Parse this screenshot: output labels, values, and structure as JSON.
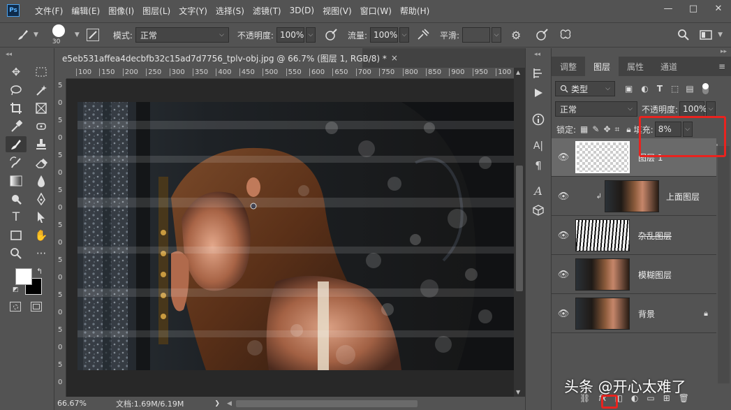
{
  "app": {
    "logo": "Ps"
  },
  "menu": [
    "文件(F)",
    "编辑(E)",
    "图像(I)",
    "图层(L)",
    "文字(Y)",
    "选择(S)",
    "滤镜(T)",
    "3D(D)",
    "视图(V)",
    "窗口(W)",
    "帮助(H)"
  ],
  "window_controls": {
    "minimize": "—",
    "restore": "□",
    "close": "✕"
  },
  "options": {
    "brush_size": "30",
    "mode_label": "模式:",
    "mode_value": "正常",
    "opacity_label": "不透明度:",
    "opacity_value": "100%",
    "flow_label": "流量:",
    "flow_value": "100%",
    "smooth_label": "平滑:",
    "smooth_value": ""
  },
  "document": {
    "tab_title": "e5eb531affea4decbfb32c15ad7d7756_tplv-obj.jpg @ 66.7% (图层 1, RGB/8) *",
    "close": "×",
    "ruler_h": [
      "100",
      "150",
      "200",
      "250",
      "300",
      "350",
      "400",
      "450",
      "500",
      "550",
      "600",
      "650",
      "700",
      "750",
      "800",
      "850",
      "900",
      "950",
      "100"
    ],
    "ruler_v": [
      "5",
      "0",
      "5",
      "0",
      "5",
      "0",
      "5",
      "0",
      "5",
      "0",
      "5",
      "0",
      "5",
      "0",
      "5",
      "0",
      "5",
      "0"
    ],
    "zoom": "66.67%",
    "doc_size": "文档:1.69M/6.19M"
  },
  "layers_panel": {
    "tabs": [
      "调整",
      "图层",
      "属性",
      "通道"
    ],
    "active_tab": "图层",
    "filter_kind": "类型",
    "blend_mode": "正常",
    "opacity_label": "不透明度:",
    "opacity_value": "100%",
    "lock_label": "锁定:",
    "fill_label": "填充:",
    "fill_value": "8%",
    "fill_slider_fraction": 0.08,
    "layers": [
      {
        "name": "图层 1",
        "selected": true,
        "type": "transparent"
      },
      {
        "name": "上面图层",
        "selected": false,
        "type": "photo",
        "clipped": true
      },
      {
        "name": "杂乱图层",
        "selected": false,
        "type": "stripes"
      },
      {
        "name": "模糊图层",
        "selected": false,
        "type": "photo"
      },
      {
        "name": "背景",
        "selected": false,
        "type": "photo",
        "locked": true
      }
    ]
  },
  "watermark": "头条 @开心太难了",
  "accent": {
    "highlight": "#e8231f",
    "panel_bg": "#535353",
    "canvas_bg": "#282828"
  }
}
